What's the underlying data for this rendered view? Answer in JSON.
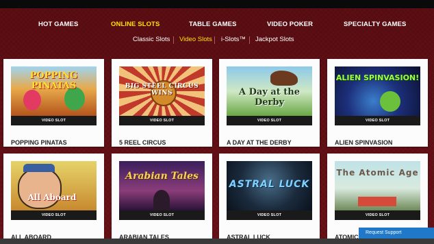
{
  "main_nav": [
    {
      "label": "HOT GAMES",
      "active": false
    },
    {
      "label": "ONLINE SLOTS",
      "active": true
    },
    {
      "label": "TABLE GAMES",
      "active": false
    },
    {
      "label": "VIDEO POKER",
      "active": false
    },
    {
      "label": "SPECIALTY GAMES",
      "active": false
    }
  ],
  "sub_nav": [
    {
      "label": "Classic Slots",
      "active": false
    },
    {
      "label": "Video Slots",
      "active": true
    },
    {
      "label": "i-Slots™",
      "active": false
    },
    {
      "label": "Jackpot Slots",
      "active": false
    }
  ],
  "games": [
    {
      "title": "POPPING PINATAS",
      "badge": "VIDEO SLOT",
      "logo_text": "POPPING PINATAS"
    },
    {
      "title": "5 REEL CIRCUS",
      "badge": "VIDEO SLOT",
      "logo_text": "BIG STEEL CIRCUS WINS"
    },
    {
      "title": "A DAY AT THE DERBY",
      "badge": "VIDEO SLOT",
      "logo_text": "A Day at the Derby"
    },
    {
      "title": "ALIEN SPINVASION",
      "badge": "VIDEO SLOT",
      "logo_text": "ALIEN SPINVASION!"
    },
    {
      "title": "ALL ABOARD",
      "badge": "VIDEO SLOT",
      "logo_text": "All Aboard"
    },
    {
      "title": "ARABIAN TALES",
      "badge": "VIDEO SLOT",
      "logo_text": "Arabian Tales"
    },
    {
      "title": "ASTRAL LUCK",
      "badge": "VIDEO SLOT",
      "logo_text": "ASTRAL LUCK"
    },
    {
      "title": "ATOMIC AGE",
      "badge": "VIDEO SLOT",
      "logo_text": "The Atomic Age"
    }
  ],
  "support": {
    "label": "Request Support"
  }
}
